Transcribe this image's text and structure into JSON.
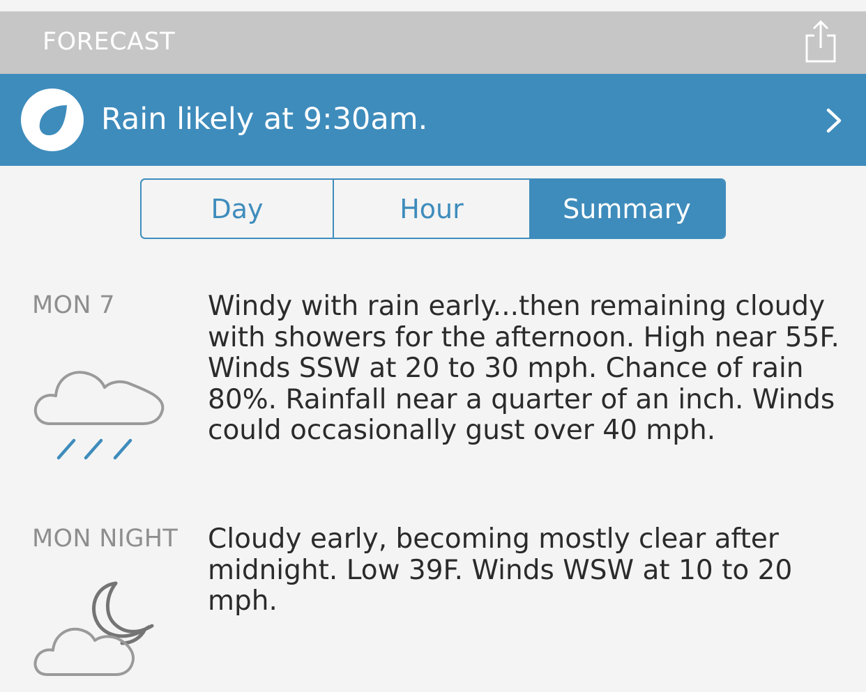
{
  "header": {
    "title": "FORECAST",
    "share_icon": "share-icon"
  },
  "alert": {
    "icon": "raindrop-icon",
    "text": "Rain likely at 9:30am.",
    "chevron_icon": "chevron-right-icon"
  },
  "tabs": [
    {
      "label": "Day",
      "selected": false
    },
    {
      "label": "Hour",
      "selected": false
    },
    {
      "label": "Summary",
      "selected": true
    }
  ],
  "forecast": [
    {
      "period": "MON 7",
      "icon": "cloud-rain-icon",
      "text": "Windy with rain early...then remaining cloudy with showers for the afternoon. High near 55F. Winds SSW at 20 to 30 mph. Chance of rain 80%. Rainfall near a quarter of an inch. Winds could occasionally gust over 40 mph."
    },
    {
      "period": "MON NIGHT",
      "icon": "partly-cloudy-night-icon",
      "text": "Cloudy early, becoming mostly clear after midnight. Low 39F. Winds WSW at 10 to 20 mph."
    }
  ],
  "colors": {
    "accent": "#3e8cbc",
    "header_bg": "#c6c6c6",
    "background": "#f4f4f4",
    "icon_gray": "#9a9a9a",
    "rain_blue": "#3e8cbc"
  }
}
